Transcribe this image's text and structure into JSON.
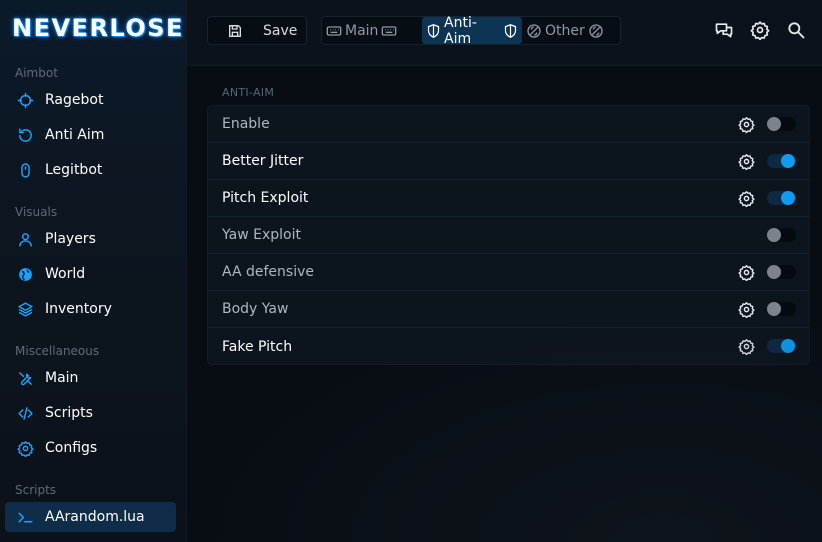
{
  "logo": "NEVERLOSE",
  "sidebar": {
    "sections": [
      {
        "title": "Aimbot",
        "items": [
          {
            "label": "Ragebot",
            "icon": "crosshair-icon"
          },
          {
            "label": "Anti Aim",
            "icon": "rotate-icon"
          },
          {
            "label": "Legitbot",
            "icon": "mouse-icon"
          }
        ]
      },
      {
        "title": "Visuals",
        "items": [
          {
            "label": "Players",
            "icon": "user-icon"
          },
          {
            "label": "World",
            "icon": "globe-icon"
          },
          {
            "label": "Inventory",
            "icon": "layers-icon"
          }
        ]
      },
      {
        "title": "Miscellaneous",
        "items": [
          {
            "label": "Main",
            "icon": "tools-icon"
          },
          {
            "label": "Scripts",
            "icon": "code-icon"
          },
          {
            "label": "Configs",
            "icon": "gear-icon"
          }
        ]
      },
      {
        "title": "Scripts",
        "items": [
          {
            "label": "AArandom.lua",
            "icon": "terminal-icon",
            "active": true
          }
        ]
      }
    ]
  },
  "topbar": {
    "save_label": "Save",
    "tabs": [
      {
        "label": "Main",
        "active": false
      },
      {
        "label": "Anti-Aim",
        "active": true
      },
      {
        "label": "Other",
        "active": false
      }
    ]
  },
  "group": {
    "title": "ANTI-AIM",
    "rows": [
      {
        "label": "Enable",
        "enabled": false,
        "has_settings": true
      },
      {
        "label": "Better Jitter",
        "enabled": true,
        "has_settings": true
      },
      {
        "label": "Pitch Exploit",
        "enabled": true,
        "has_settings": true
      },
      {
        "label": "Yaw Exploit",
        "enabled": false,
        "has_settings": false
      },
      {
        "label": "AA defensive",
        "enabled": false,
        "has_settings": true
      },
      {
        "label": "Body Yaw",
        "enabled": false,
        "has_settings": true
      },
      {
        "label": "Fake Pitch",
        "enabled": true,
        "has_settings": true
      }
    ]
  },
  "colors": {
    "accent": "#0e9cf0",
    "active_bg": "#0f2d48",
    "toggle_off_knob": "#7c838b"
  }
}
